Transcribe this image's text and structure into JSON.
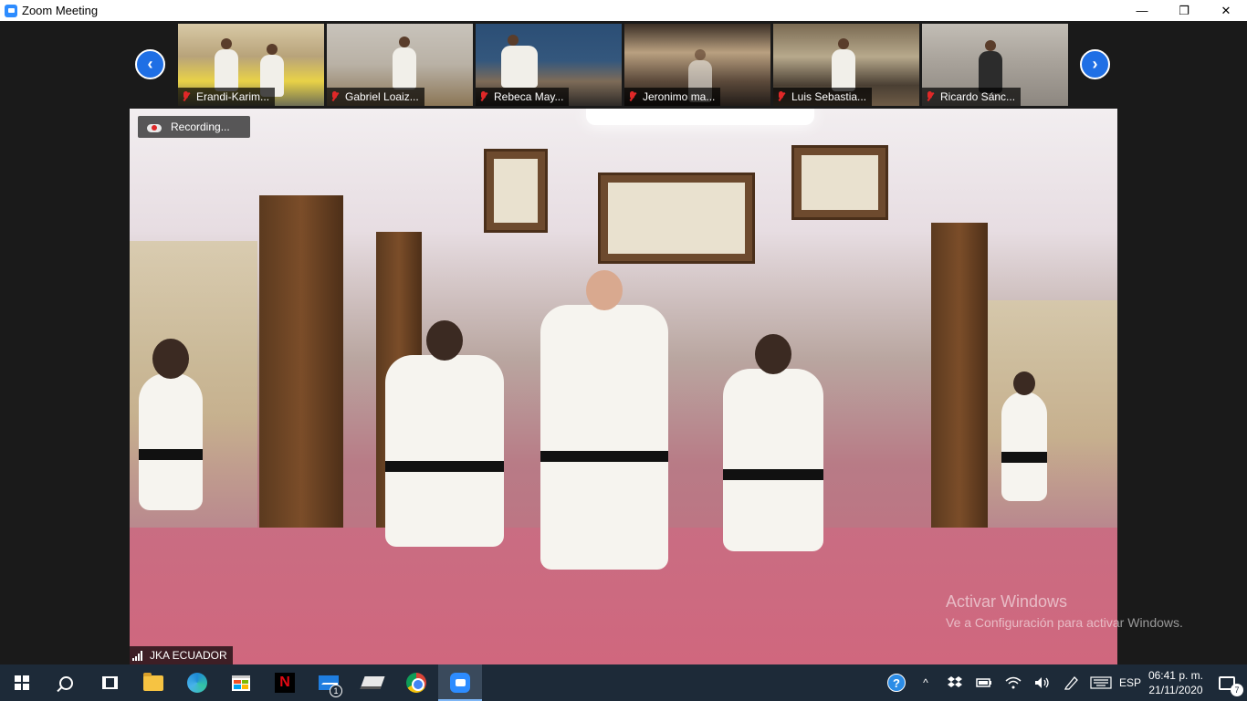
{
  "window": {
    "title": "Zoom Meeting",
    "controls": {
      "minimize": "—",
      "restore": "❐",
      "close": "✕"
    }
  },
  "gallery": {
    "prev_icon": "‹",
    "next_icon": "›",
    "participants": [
      {
        "name": "Erandi-Karim...",
        "muted": true
      },
      {
        "name": "Gabriel Loaiz...",
        "muted": true
      },
      {
        "name": "Rebeca May...",
        "muted": true
      },
      {
        "name": "Jeronimo ma...",
        "muted": true
      },
      {
        "name": "Luis Sebastia...",
        "muted": true
      },
      {
        "name": "Ricardo Sánc...",
        "muted": true
      }
    ]
  },
  "main_video": {
    "recording_label": "Recording...",
    "speaker_name": "JKA ECUADOR"
  },
  "watermark": {
    "line1": "Activar Windows",
    "line2": "Ve a Configuración para activar Windows."
  },
  "taskbar": {
    "apps": [
      "start-icon",
      "search-icon",
      "task-view-icon",
      "file-explorer-icon",
      "edge-icon",
      "store-icon",
      "netflix-icon",
      "mail-icon",
      "book-icon",
      "chrome-icon",
      "zoom-icon"
    ],
    "netflix_letter": "N",
    "mail_badge": "1",
    "tray": {
      "help": "?",
      "chevron": "^",
      "language": "ESP",
      "time": "06:41 p. m.",
      "date": "21/11/2020",
      "notification_count": "7"
    }
  },
  "colors": {
    "zoom_blue": "#2d8cff",
    "nav_arrow": "#1f6fe5",
    "muted_red": "#e02828",
    "taskbar_bg": "#1d2a38"
  }
}
